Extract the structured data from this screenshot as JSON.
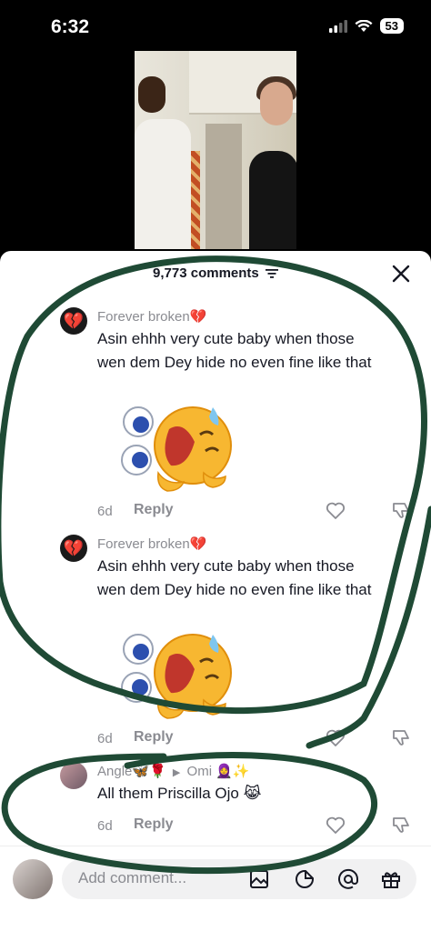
{
  "status_bar": {
    "time": "6:32",
    "battery": "53"
  },
  "comments_header": {
    "count_label": "9,773 comments"
  },
  "comments": [
    {
      "username": "Forever broken",
      "username_emoji": "💔",
      "text": "Asin ehhh very cute baby when those wen dem Dey hide no even fine like that",
      "line1": "Asin ehhh very cute baby when those",
      "line2": "wen dem Dey hide no even fine like that",
      "sticker": "crying-laughing-emoji-sticker",
      "time": "6d",
      "reply_label": "Reply"
    },
    {
      "username": "Forever broken",
      "username_emoji": "💔",
      "text": "Asin ehhh very cute baby when those wen dem Dey hide no even fine like that",
      "line1": "Asin ehhh very cute baby when those",
      "line2": "wen dem Dey hide no even fine like that",
      "sticker": "crying-laughing-emoji-sticker",
      "time": "6d",
      "reply_label": "Reply"
    },
    {
      "username": "Angle",
      "username_suffix": "🦋🌹",
      "reply_to": "Omi",
      "reply_to_emoji": "🧕✨",
      "text": "All them Priscilla Ojo 😹",
      "time": "6d",
      "reply_label": "Reply"
    }
  ],
  "input": {
    "placeholder": "Add comment..."
  },
  "colors": {
    "annotation_stroke": "#1f4a35",
    "sheet_bg": "#ffffff",
    "muted_text": "#8a8b91",
    "primary_text": "#161823"
  }
}
